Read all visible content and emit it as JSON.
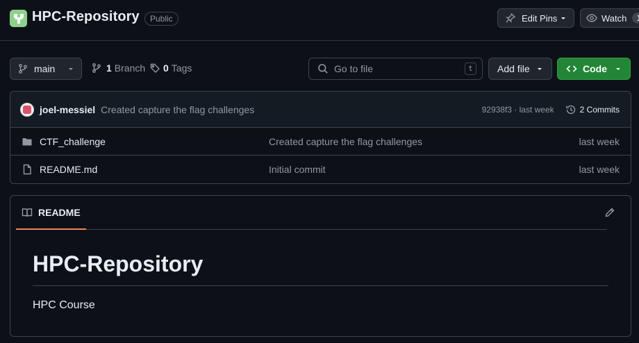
{
  "repo": {
    "name": "HPC-Repository",
    "visibility": "Public"
  },
  "header": {
    "edit_pins_label": "Edit Pins",
    "watch_label": "Watch",
    "watch_count": "1"
  },
  "toolbar": {
    "branch_name": "main",
    "branch_count": "1",
    "branch_label": "Branch",
    "tag_count": "0",
    "tag_label": "Tags",
    "search_placeholder": "Go to file",
    "search_shortcut": "t",
    "add_file_label": "Add file",
    "code_label": "Code"
  },
  "latest_commit": {
    "author": "joel-messiel",
    "message": "Created capture the flag challenges",
    "hash_time": "92938f3 · last week",
    "commits_label": "2 Commits"
  },
  "files": [
    {
      "name": "CTF_challenge",
      "type": "folder",
      "commit": "Created capture the flag challenges",
      "time": "last week"
    },
    {
      "name": "README.md",
      "type": "file",
      "commit": "Initial commit",
      "time": "last week"
    }
  ],
  "readme": {
    "tab_label": "README",
    "heading": "HPC-Repository",
    "body": "HPC Course"
  },
  "colors": {
    "background": "#0d1117",
    "border": "#3d444d",
    "muted_text": "#9198a1",
    "primary_green": "#238636",
    "tab_underline": "#f78166"
  },
  "icons": {
    "repo": "repo-logo-icon",
    "pin": "pin-icon",
    "eye": "eye-icon",
    "branch": "git-branch-icon",
    "tag": "tag-icon",
    "search": "search-icon",
    "code": "code-icon",
    "history": "history-icon",
    "folder": "folder-icon",
    "file": "file-icon",
    "book": "book-icon",
    "pencil": "pencil-icon"
  }
}
